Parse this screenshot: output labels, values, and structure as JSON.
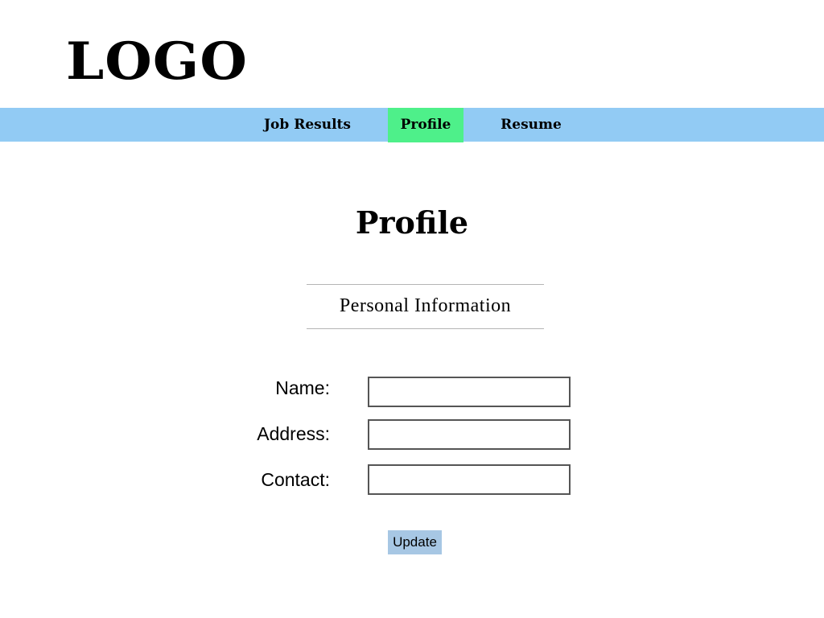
{
  "header": {
    "logo_text": "LOGO"
  },
  "nav": {
    "tabs": [
      {
        "label": "Job Results",
        "active": false
      },
      {
        "label": "Profile",
        "active": true
      },
      {
        "label": "Resume",
        "active": false
      }
    ]
  },
  "main": {
    "title": "Profile",
    "section_heading": "Personal Information",
    "fields": [
      {
        "label": "Name:",
        "value": "",
        "placeholder": ""
      },
      {
        "label": "Address:",
        "value": "",
        "placeholder": ""
      },
      {
        "label": "Contact:",
        "value": "",
        "placeholder": ""
      }
    ],
    "update_label": "Update"
  },
  "colors": {
    "nav_background": "#92cbf4",
    "active_tab": "#4ef08a",
    "update_button": "#a7c7e4",
    "divider": "#b5b5b5"
  }
}
